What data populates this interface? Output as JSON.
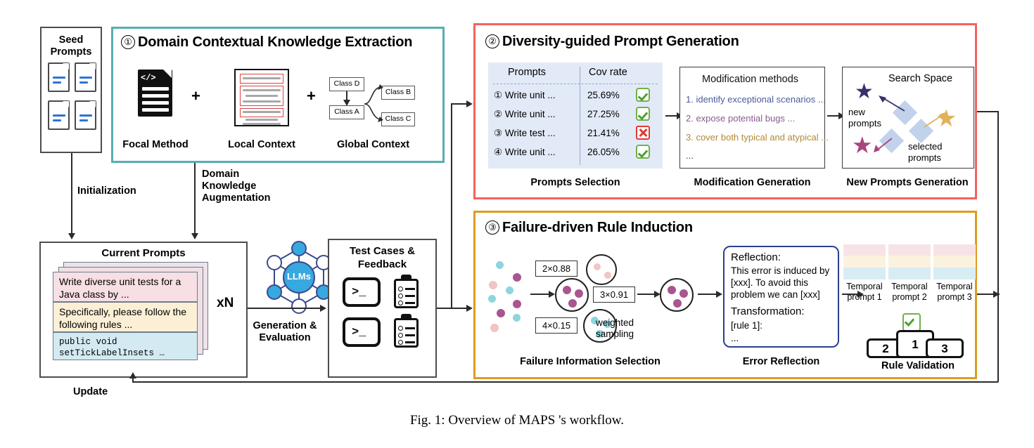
{
  "figure": {
    "caption": "Fig. 1: Overview of MAPS 's workflow."
  },
  "seed": {
    "title_line1": "Seed",
    "title_line2": "Prompts"
  },
  "section1": {
    "number": "①",
    "title": "Domain Contextual Knowledge Extraction",
    "items": [
      {
        "label": "Focal Method",
        "icon": "code-document-icon"
      },
      {
        "label": "Local Context",
        "icon": "highlighted-document-icon"
      },
      {
        "label": "Global Context",
        "icon": "class-diagram-icon"
      }
    ],
    "plus": "+",
    "classes": {
      "d": "Class D",
      "a": "Class A",
      "b": "Class B",
      "c": "Class C"
    }
  },
  "section2": {
    "number": "②",
    "title": "Diversity-guided Prompt Generation",
    "table": {
      "headers": [
        "Prompts",
        "Cov rate"
      ],
      "rows": [
        {
          "prompt": "① Write unit ...",
          "cov": "25.69%",
          "status": "check"
        },
        {
          "prompt": "② Write unit ...",
          "cov": "27.25%",
          "status": "check"
        },
        {
          "prompt": "③ Write test ...",
          "cov": "21.41%",
          "status": "cross"
        },
        {
          "prompt": "④ Write unit ...",
          "cov": "26.05%",
          "status": "check"
        }
      ],
      "caption": "Prompts Selection"
    },
    "modification": {
      "title": "Modification methods",
      "items": [
        {
          "text": "1. identify exceptional scenarios ...",
          "color": "#4b5b9e"
        },
        {
          "text": "2. expose potential bugs ...",
          "color": "#8b5a8f"
        },
        {
          "text": "3. cover both typical and atypical ...",
          "color": "#b08a33"
        }
      ],
      "ellipsis": "...",
      "caption": "Modification Generation"
    },
    "search_space": {
      "title": "Search Space",
      "label_new": "new\nprompts",
      "label_new_l1": "new",
      "label_new_l2": "prompts",
      "label_selected_l1": "selected",
      "label_selected_l2": "prompts",
      "caption": "New Prompts Generation",
      "star_colors": [
        "#38306b",
        "#e0b25c",
        "#a8467e"
      ],
      "diamond_color": "#c2d2ec"
    }
  },
  "section3": {
    "number": "③",
    "title": "Failure-driven Rule Induction",
    "selection": {
      "weights": [
        "2×0.88",
        "3×0.91",
        "4×0.15"
      ],
      "sampling_l1": "weighted",
      "sampling_l2": "sampling",
      "caption": "Failure Information Selection"
    },
    "reflection": {
      "line1": "Reflection:",
      "line2": "This error is induced by",
      "line3": "[xxx]. To avoid this",
      "line4": "problem we can [xxx]",
      "line5": "Transformation:",
      "line6": "[rule 1]:",
      "line7": "...",
      "caption": "Error Reflection"
    },
    "validation": {
      "temporal": [
        {
          "l1": "Temporal",
          "l2": "prompt 1"
        },
        {
          "l1": "Temporal",
          "l2": "prompt 2"
        },
        {
          "l1": "Temporal",
          "l2": "prompt 3"
        }
      ],
      "podium": [
        "2",
        "1",
        "3"
      ],
      "caption": "Rule Validation"
    }
  },
  "current_prompts": {
    "title": "Current Prompts",
    "multiplier": "xN",
    "cards": [
      {
        "text": "Write diverse unit tests for a\nJava class by  ...",
        "l1": "Write diverse unit tests for a",
        "l2": "Java class by  ...",
        "color": "#f7dfe4"
      },
      {
        "text": "Specifically, please follow the\nfollowing rules   ...",
        "l1": "Specifically, please follow the",
        "l2": "following rules   ...",
        "color": "#fbf0d6"
      },
      {
        "l1": "public void",
        "l2": "setTickLabelInsets …",
        "color": "#d4eaf2"
      }
    ]
  },
  "llm": {
    "label": "LLMs"
  },
  "test_cases": {
    "title_l1": "Test Cases &",
    "title_l2": "Feedback",
    "terminal_glyph": ">_"
  },
  "arrows": {
    "initialization": "Initialization",
    "domain_aug_l1": "Domain",
    "domain_aug_l2": "Knowledge",
    "domain_aug_l3": "Augmentation",
    "generation_l1": "Generation &",
    "generation_l2": "Evaluation",
    "update": "Update"
  },
  "colors": {
    "teal": "#56aeb4",
    "red": "#f4635c",
    "orange": "#dd9c21",
    "table_bg": "#e3eaf7",
    "check_green": "#71b14b",
    "cross_red": "#e03a35"
  }
}
